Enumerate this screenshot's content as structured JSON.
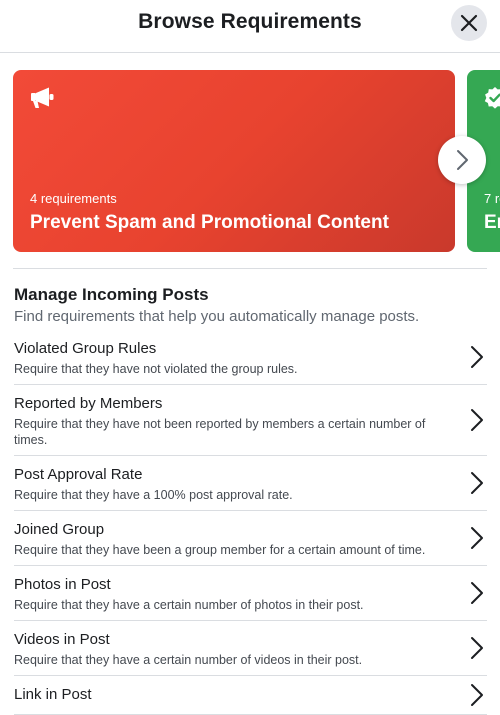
{
  "header": {
    "title": "Browse Requirements"
  },
  "cards": [
    {
      "count": "4 requirements",
      "title": "Prevent Spam and Promotional Content",
      "icon": "megaphone-icon",
      "color": "#e8432f"
    },
    {
      "count": "7 re",
      "title": "En",
      "icon": "verified-badge-icon",
      "color": "#35a853"
    }
  ],
  "section": {
    "title": "Manage Incoming Posts",
    "subtitle": "Find requirements that help you automatically manage posts."
  },
  "items": [
    {
      "title": "Violated Group Rules",
      "desc": "Require that they have not violated the group rules."
    },
    {
      "title": "Reported by Members",
      "desc": "Require that they have not been reported by members a certain number of times."
    },
    {
      "title": "Post Approval Rate",
      "desc": "Require that they have a 100% post approval rate."
    },
    {
      "title": "Joined Group",
      "desc": "Require that they have been a group member for a certain amount of time."
    },
    {
      "title": "Photos in Post",
      "desc": "Require that they have a certain number of photos in their post."
    },
    {
      "title": "Videos in Post",
      "desc": "Require that they have a certain number of videos in their post."
    },
    {
      "title": "Link in Post",
      "desc": ""
    }
  ]
}
